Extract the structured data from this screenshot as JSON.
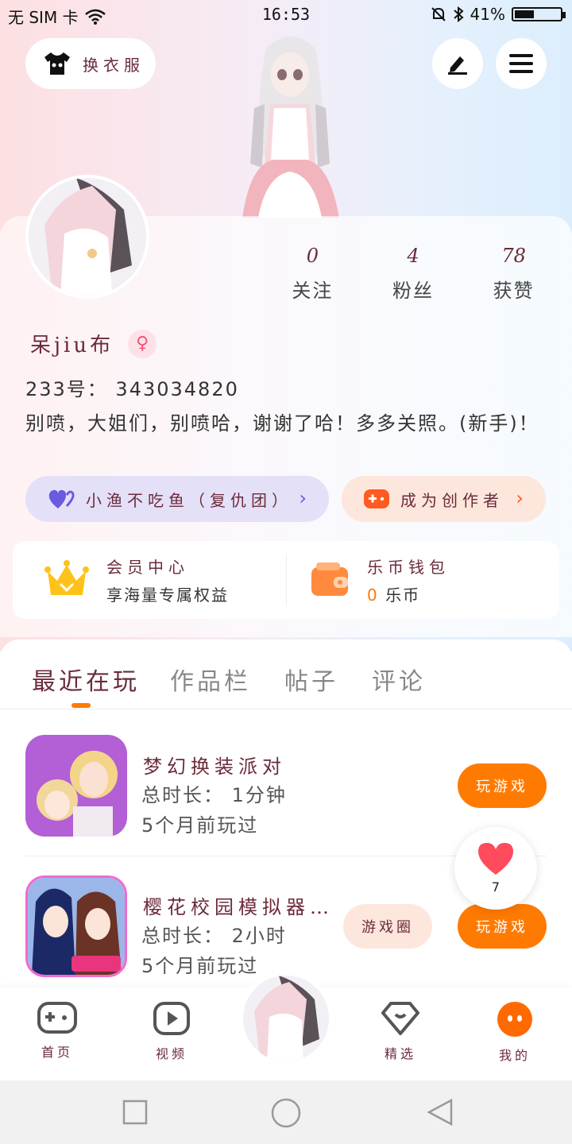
{
  "status_bar": {
    "carrier": "无 SIM 卡",
    "time": "16:53",
    "battery": "41%"
  },
  "header": {
    "outfit_label": "换衣服"
  },
  "profile": {
    "stats": [
      {
        "value": "0",
        "label": "关注"
      },
      {
        "value": "4",
        "label": "粉丝"
      },
      {
        "value": "78",
        "label": "获赞"
      }
    ],
    "nickname": "呆jiu布",
    "uid": "233号： 343034820",
    "bio": "别喷，大姐们，别喷哈，谢谢了哈！多多关照。(新手)！",
    "group_chip": "小渔不吃鱼（复仇团）",
    "creator_chip": "成为创作者"
  },
  "vip": {
    "title": "会员中心",
    "subtitle": "享海量专属权益",
    "wallet_title": "乐币钱包",
    "wallet_amount": "0",
    "wallet_unit": "乐币"
  },
  "tabs": [
    "最近在玩",
    "作品栏",
    "帖子",
    "评论"
  ],
  "games": [
    {
      "title": "梦幻换装派对",
      "duration": "总时长： 1分钟",
      "last_played": "5个月前玩过",
      "play_label": "玩游戏"
    },
    {
      "title": "樱花校园模拟器…",
      "duration": "总时长： 2小时",
      "last_played": "5个月前玩过",
      "play_label": "玩游戏",
      "circle_label": "游戏圈"
    }
  ],
  "like_count": "7",
  "bottom_nav": [
    "首页",
    "视频",
    "精选",
    "我的"
  ],
  "colors": {
    "accent": "#ff7a00",
    "label": "#6b2b3a"
  }
}
